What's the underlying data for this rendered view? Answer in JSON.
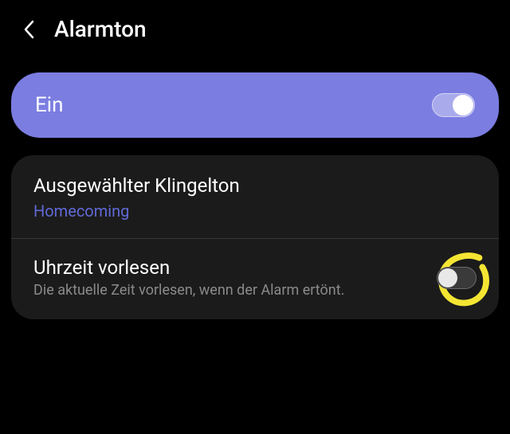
{
  "header": {
    "title": "Alarmton"
  },
  "main_toggle": {
    "label": "Ein",
    "state": true
  },
  "ringtone": {
    "title": "Ausgewählter Klingelton",
    "value": "Homecoming"
  },
  "read_time": {
    "title": "Uhrzeit vorlesen",
    "description": "Die aktuelle Zeit vorlesen, wenn der Alarm ertönt.",
    "state": false
  },
  "colors": {
    "accent": "#7B7DE1",
    "link": "#6069D6",
    "annotation": "#F5E533"
  }
}
